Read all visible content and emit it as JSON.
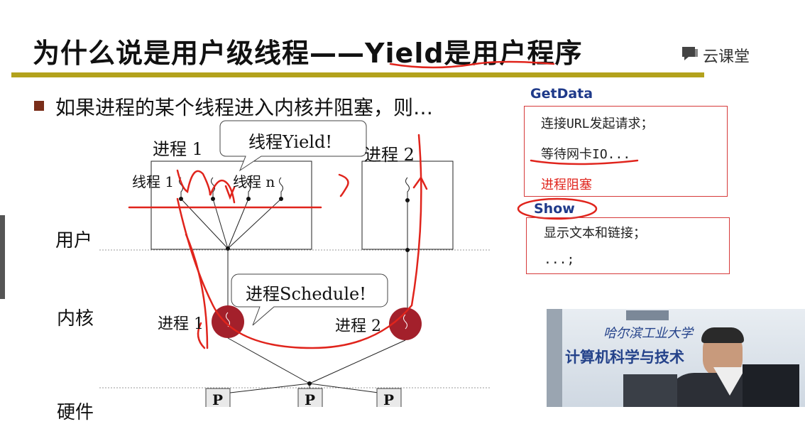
{
  "slide": {
    "title": "为什么说是用户级线程——Yield是用户程序",
    "logo_text": "云课堂",
    "bullet": "如果进程的某个线程进入内核并阻塞，则…"
  },
  "diagram": {
    "process1_label": "进程 1",
    "process2_label": "进程 2",
    "thread1_label": "线程 1",
    "threadn_label": "线程 n",
    "bubble_yield": "线程Yield!",
    "bubble_schedule": "进程Schedule!",
    "row_user": "用户",
    "row_kernel": "内核",
    "row_hardware": "硬件",
    "kernel_p1": "进程 1",
    "kernel_p2": "进程 2",
    "cpu_labels": [
      "P",
      "P",
      "P"
    ]
  },
  "side_panel": {
    "getdata_title": "GetData",
    "getdata_lines": [
      "连接URL发起请求；",
      "等待网卡IO...",
      "进程阻塞"
    ],
    "show_title": "Show",
    "show_lines": [
      "显示文本和链接；",
      "...;"
    ]
  },
  "video": {
    "banner_line1": "哈尔滨工业大学",
    "banner_line2": "计算机科学与技术"
  },
  "colors": {
    "title_rule": "#b3a21c",
    "bullet": "#7a2e1a",
    "annotation_red": "#e0241c",
    "panel_title_blue": "#1f3a8a",
    "kernel_ball": "#a3202b"
  }
}
